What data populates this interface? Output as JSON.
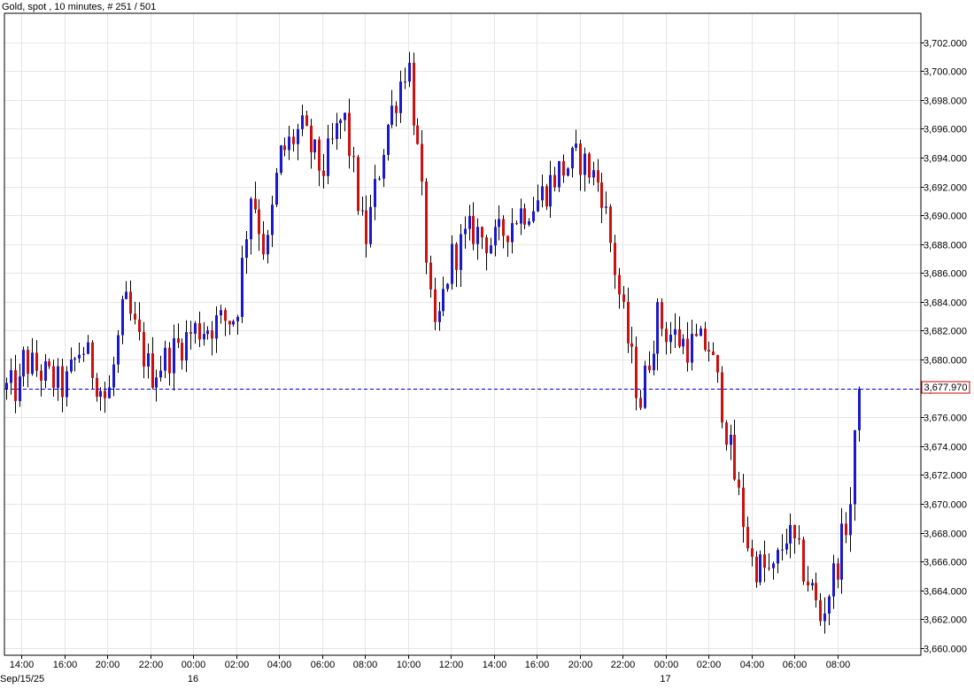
{
  "chart_data": {
    "type": "candlestick",
    "title": "Gold, spot , 10 minutes, # 251 / 501",
    "ylim": [
      3659.5,
      3704.0
    ],
    "y_ticks": [
      3660,
      3662,
      3664,
      3666,
      3668,
      3670,
      3672,
      3674,
      3676,
      3678,
      3680,
      3682,
      3684,
      3686,
      3688,
      3690,
      3692,
      3694,
      3696,
      3698,
      3700,
      3702
    ],
    "y_tick_labels": [
      "3,660.000",
      "3,662.000",
      "3,664.000",
      "3,666.000",
      "3,668.000",
      "3,670.000",
      "3,672.000",
      "3,674.000",
      "3,676.000",
      "3,678.000",
      "3,680.000",
      "3,682.000",
      "3,684.000",
      "3,686.000",
      "3,688.000",
      "3,690.000",
      "3,692.000",
      "3,694.000",
      "3,696.000",
      "3,698.000",
      "3,700.000",
      "3,702.000"
    ],
    "x_ticks": [
      "14:00",
      "16:00",
      "20:00",
      "22:00",
      "00:00",
      "02:00",
      "04:00",
      "06:00",
      "08:00",
      "10:00",
      "12:00",
      "14:00",
      "16:00",
      "20:00",
      "22:00",
      "00:00",
      "02:00",
      "04:00",
      "06:00",
      "08:00"
    ],
    "date_labels": [
      {
        "after_tick": 0,
        "label": "Sep/15/25"
      },
      {
        "after_tick": 4,
        "label": "16"
      },
      {
        "after_tick": 15,
        "label": "17"
      }
    ],
    "grid": true,
    "current_price": 3677.97,
    "current_price_label": "3,677.970",
    "up_color": "#1a1acc",
    "down_color": "#cc1111",
    "price_line_color": "#0000cc",
    "anchors": [
      {
        "tick": 0,
        "price": 3680
      },
      {
        "tick": 1,
        "price": 3678
      },
      {
        "tick": 1.4,
        "price": 3681
      },
      {
        "tick": 2,
        "price": 3677
      },
      {
        "tick": 2.4,
        "price": 3684
      },
      {
        "tick": 3,
        "price": 3679
      },
      {
        "tick": 4,
        "price": 3682
      },
      {
        "tick": 5,
        "price": 3683
      },
      {
        "tick": 5.35,
        "price": 3692
      },
      {
        "tick": 5.7,
        "price": 3687
      },
      {
        "tick": 6,
        "price": 3694
      },
      {
        "tick": 6.5,
        "price": 3696
      },
      {
        "tick": 7,
        "price": 3693
      },
      {
        "tick": 7.5,
        "price": 3697
      },
      {
        "tick": 8,
        "price": 3688
      },
      {
        "tick": 8.5,
        "price": 3696
      },
      {
        "tick": 9,
        "price": 3701
      },
      {
        "tick": 9.3,
        "price": 3692
      },
      {
        "tick": 9.6,
        "price": 3681
      },
      {
        "tick": 10,
        "price": 3687
      },
      {
        "tick": 10.5,
        "price": 3689
      },
      {
        "tick": 11,
        "price": 3688
      },
      {
        "tick": 11.5,
        "price": 3690
      },
      {
        "tick": 12,
        "price": 3691
      },
      {
        "tick": 12.5,
        "price": 3693
      },
      {
        "tick": 13,
        "price": 3694
      },
      {
        "tick": 13.5,
        "price": 3692
      },
      {
        "tick": 14,
        "price": 3683
      },
      {
        "tick": 14.4,
        "price": 3677
      },
      {
        "tick": 14.8,
        "price": 3683
      },
      {
        "tick": 15,
        "price": 3682
      },
      {
        "tick": 15.5,
        "price": 3681
      },
      {
        "tick": 16,
        "price": 3681
      },
      {
        "tick": 16.3,
        "price": 3677
      },
      {
        "tick": 16.6,
        "price": 3672
      },
      {
        "tick": 17,
        "price": 3666
      },
      {
        "tick": 17.5,
        "price": 3665
      },
      {
        "tick": 17.8,
        "price": 3668
      },
      {
        "tick": 18,
        "price": 3667
      },
      {
        "tick": 18.4,
        "price": 3664
      },
      {
        "tick": 18.6,
        "price": 3662
      },
      {
        "tick": 19,
        "price": 3666
      },
      {
        "tick": 19.3,
        "price": 3670
      },
      {
        "tick": 19.5,
        "price": 3677.97
      }
    ]
  }
}
